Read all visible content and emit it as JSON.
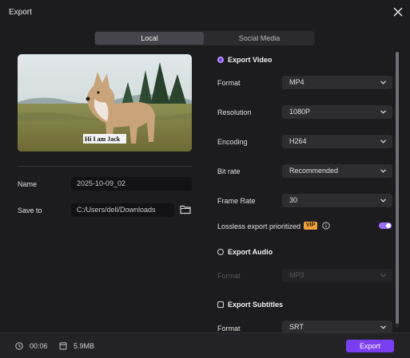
{
  "window": {
    "title": "Export"
  },
  "tabs": {
    "local": "Local",
    "social": "Social Media"
  },
  "preview": {
    "caption": "Hi  I am Jack"
  },
  "left": {
    "name_label": "Name",
    "name_value": "2025-10-09_02",
    "saveto_label": "Save to",
    "saveto_value": "C:/Users/dell/Downloads"
  },
  "export_video": {
    "title": "Export Video",
    "format_label": "Format",
    "format_value": "MP4",
    "resolution_label": "Resolution",
    "resolution_value": "1080P",
    "encoding_label": "Encoding",
    "encoding_value": "H264",
    "bitrate_label": "Bit rate",
    "bitrate_value": "Recommended",
    "framerate_label": "Frame Rate",
    "framerate_value": "30",
    "lossless_label": "Lossless export prioritized",
    "vip_badge": "VIP",
    "lossless_enabled": true
  },
  "export_audio": {
    "title": "Export Audio",
    "format_label": "Format",
    "format_value": "MP3"
  },
  "export_subtitles": {
    "title": "Export Subtitles",
    "format_label": "Format",
    "format_value": "SRT"
  },
  "footer": {
    "duration": "00:06",
    "size": "5.9MB",
    "export_label": "Export"
  },
  "colors": {
    "accent": "#7b3ff2",
    "vip": "#f0a13c",
    "background": "#1c1c1f"
  },
  "icons": [
    "close-icon",
    "folder-icon",
    "info-icon",
    "chevron-down-icon",
    "clock-icon",
    "file-icon"
  ]
}
